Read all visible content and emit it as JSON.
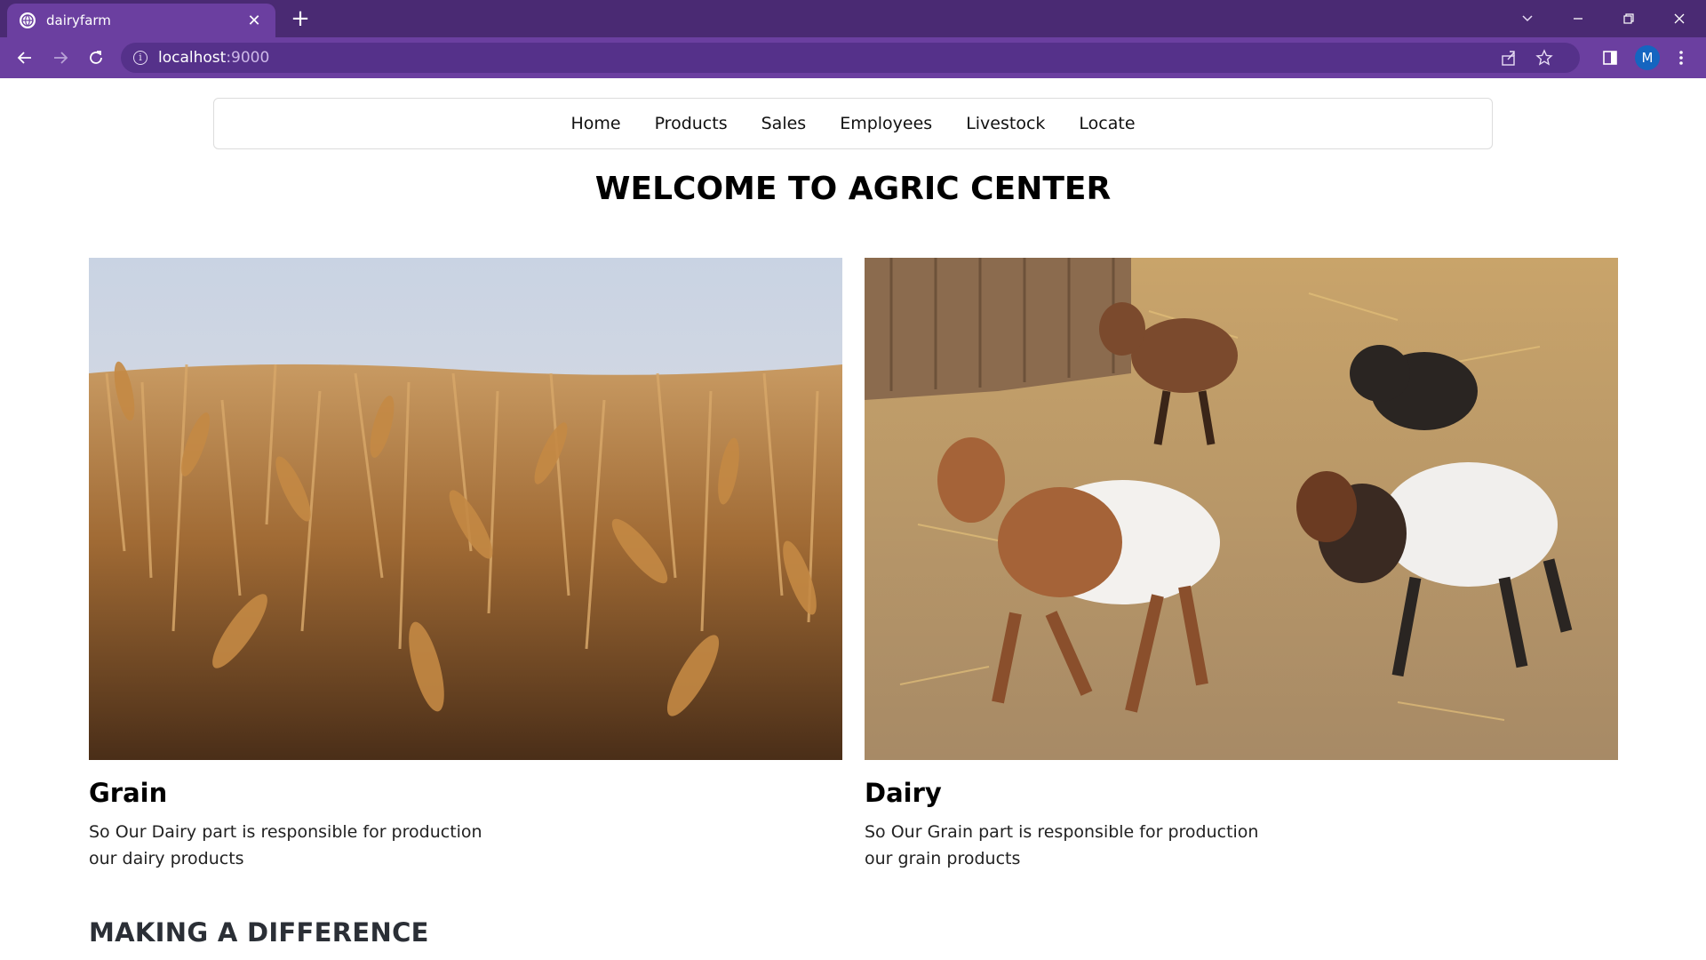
{
  "browser": {
    "tab_title": "dairyfarm",
    "url_host": "localhost",
    "url_port": ":9000",
    "profile_initial": "M",
    "theme_color": "#6b3fa0"
  },
  "nav": {
    "items": [
      "Home",
      "Products",
      "Sales",
      "Employees",
      "Livestock",
      "Locate"
    ]
  },
  "headline": "WELCOME TO AGRIC CENTER",
  "cards": [
    {
      "title": "Grain",
      "text_line1": "So Our Dairy part is responsible for production",
      "text_line2": "our dairy products",
      "image": "wheat-field-photo"
    },
    {
      "title": "Dairy",
      "text_line1": "So Our Grain part is responsible for production",
      "text_line2": "our grain products",
      "image": "goat-kids-photo"
    }
  ],
  "section_title": "MAKING A DIFFERENCE"
}
